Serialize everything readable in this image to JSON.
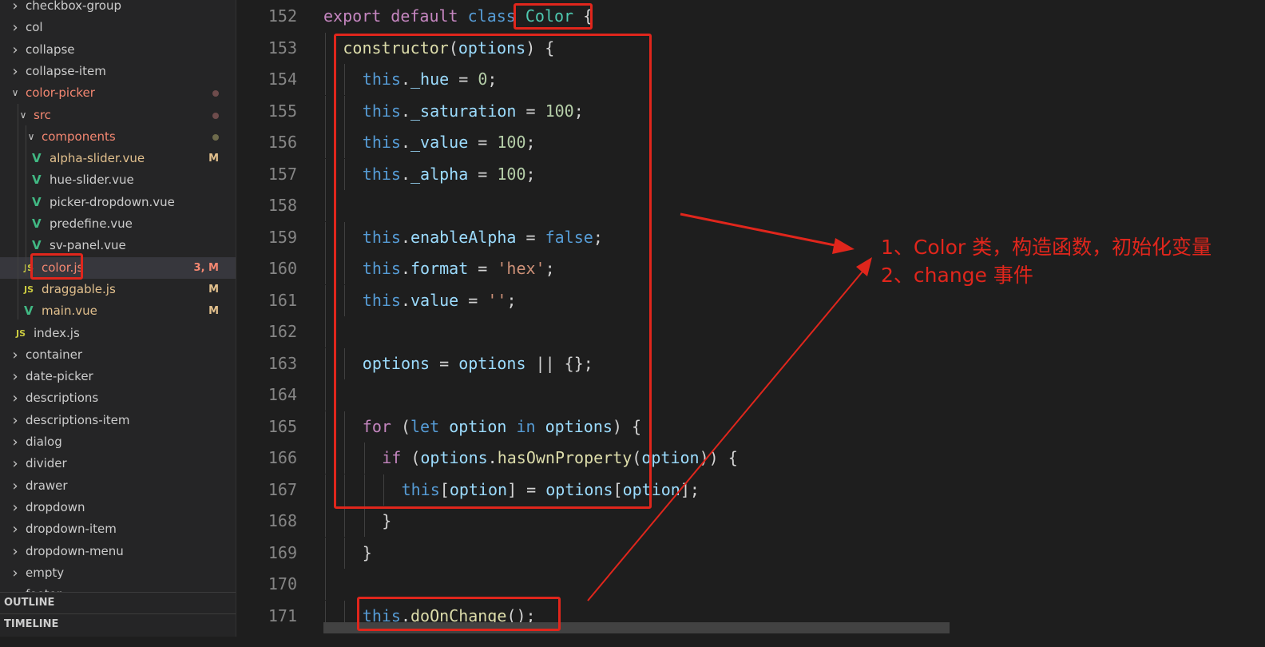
{
  "explorer": {
    "items": [
      {
        "label": "checkbox-group",
        "type": "folder",
        "state": "collapsed"
      },
      {
        "label": "col",
        "type": "folder",
        "state": "collapsed"
      },
      {
        "label": "collapse",
        "type": "folder",
        "state": "collapsed"
      },
      {
        "label": "collapse-item",
        "type": "folder",
        "state": "collapsed"
      },
      {
        "label": "color-picker",
        "type": "folder",
        "state": "expanded",
        "modified_dot": true
      },
      {
        "label": "src",
        "type": "folder",
        "state": "expanded",
        "modified_dot": true
      },
      {
        "label": "components",
        "type": "folder",
        "state": "expanded",
        "modified_dot": true
      },
      {
        "label": "alpha-slider.vue",
        "type": "vue",
        "badge": "M"
      },
      {
        "label": "hue-slider.vue",
        "type": "vue"
      },
      {
        "label": "picker-dropdown.vue",
        "type": "vue"
      },
      {
        "label": "predefine.vue",
        "type": "vue"
      },
      {
        "label": "sv-panel.vue",
        "type": "vue"
      },
      {
        "label": "color.js",
        "type": "js",
        "badge": "3, M",
        "selected": true
      },
      {
        "label": "draggable.js",
        "type": "js",
        "badge": "M"
      },
      {
        "label": "main.vue",
        "type": "vue",
        "badge": "M"
      },
      {
        "label": "index.js",
        "type": "js"
      },
      {
        "label": "container",
        "type": "folder",
        "state": "collapsed"
      },
      {
        "label": "date-picker",
        "type": "folder",
        "state": "collapsed"
      },
      {
        "label": "descriptions",
        "type": "folder",
        "state": "collapsed"
      },
      {
        "label": "descriptions-item",
        "type": "folder",
        "state": "collapsed"
      },
      {
        "label": "dialog",
        "type": "folder",
        "state": "collapsed"
      },
      {
        "label": "divider",
        "type": "folder",
        "state": "collapsed"
      },
      {
        "label": "drawer",
        "type": "folder",
        "state": "collapsed"
      },
      {
        "label": "dropdown",
        "type": "folder",
        "state": "collapsed"
      },
      {
        "label": "dropdown-item",
        "type": "folder",
        "state": "collapsed"
      },
      {
        "label": "dropdown-menu",
        "type": "folder",
        "state": "collapsed"
      },
      {
        "label": "empty",
        "type": "folder",
        "state": "collapsed"
      },
      {
        "label": "footer",
        "type": "folder",
        "state": "collapsed"
      }
    ],
    "outline_label": "OUTLINE",
    "timeline_label": "TIMELINE"
  },
  "icons": {
    "js_glyph": "JS",
    "vue_glyph": "V",
    "chevron_right": "›",
    "chevron_down": "⌄"
  },
  "colors": {
    "accent_red": "#e0261c",
    "modified": "#e2c08d",
    "error_file": "#f48771",
    "selection": "#37373d"
  },
  "editor": {
    "lines": [
      {
        "n": "152",
        "tokens": [
          [
            "export ",
            "kw"
          ],
          [
            "default ",
            "kw"
          ],
          [
            "class ",
            "kwb"
          ],
          [
            "Color",
            "cls"
          ],
          [
            " {",
            "pun"
          ]
        ]
      },
      {
        "n": "153",
        "tokens": [
          [
            "constructor",
            "fn"
          ],
          [
            "(",
            "pun"
          ],
          [
            "options",
            "prop"
          ],
          [
            ") {",
            "pun"
          ]
        ]
      },
      {
        "n": "154",
        "tokens": [
          [
            "this",
            "kwb"
          ],
          [
            ".",
            "pun"
          ],
          [
            "_hue",
            "prop"
          ],
          [
            " = ",
            "pun"
          ],
          [
            "0",
            "num"
          ],
          [
            ";",
            "pun"
          ]
        ]
      },
      {
        "n": "155",
        "tokens": [
          [
            "this",
            "kwb"
          ],
          [
            ".",
            "pun"
          ],
          [
            "_saturation",
            "prop"
          ],
          [
            " = ",
            "pun"
          ],
          [
            "100",
            "num"
          ],
          [
            ";",
            "pun"
          ]
        ]
      },
      {
        "n": "156",
        "tokens": [
          [
            "this",
            "kwb"
          ],
          [
            ".",
            "pun"
          ],
          [
            "_value",
            "prop"
          ],
          [
            " = ",
            "pun"
          ],
          [
            "100",
            "num"
          ],
          [
            ";",
            "pun"
          ]
        ]
      },
      {
        "n": "157",
        "tokens": [
          [
            "this",
            "kwb"
          ],
          [
            ".",
            "pun"
          ],
          [
            "_alpha",
            "prop"
          ],
          [
            " = ",
            "pun"
          ],
          [
            "100",
            "num"
          ],
          [
            ";",
            "pun"
          ]
        ]
      },
      {
        "n": "158",
        "tokens": []
      },
      {
        "n": "159",
        "tokens": [
          [
            "this",
            "kwb"
          ],
          [
            ".",
            "pun"
          ],
          [
            "enableAlpha",
            "prop"
          ],
          [
            " = ",
            "pun"
          ],
          [
            "false",
            "kwb"
          ],
          [
            ";",
            "pun"
          ]
        ]
      },
      {
        "n": "160",
        "tokens": [
          [
            "this",
            "kwb"
          ],
          [
            ".",
            "pun"
          ],
          [
            "format",
            "prop"
          ],
          [
            " = ",
            "pun"
          ],
          [
            "'hex'",
            "str"
          ],
          [
            ";",
            "pun"
          ]
        ]
      },
      {
        "n": "161",
        "tokens": [
          [
            "this",
            "kwb"
          ],
          [
            ".",
            "pun"
          ],
          [
            "value",
            "prop"
          ],
          [
            " = ",
            "pun"
          ],
          [
            "''",
            "str"
          ],
          [
            ";",
            "pun"
          ]
        ]
      },
      {
        "n": "162",
        "tokens": []
      },
      {
        "n": "163",
        "tokens": [
          [
            "options",
            "prop"
          ],
          [
            " = ",
            "pun"
          ],
          [
            "options",
            "prop"
          ],
          [
            " || {};",
            "pun"
          ]
        ]
      },
      {
        "n": "164",
        "tokens": []
      },
      {
        "n": "165",
        "tokens": [
          [
            "for ",
            "kw"
          ],
          [
            "(",
            "pun"
          ],
          [
            "let ",
            "kwb"
          ],
          [
            "option ",
            "prop"
          ],
          [
            "in ",
            "kwb"
          ],
          [
            "options",
            "prop"
          ],
          [
            ") {",
            "pun"
          ]
        ]
      },
      {
        "n": "166",
        "tokens": [
          [
            "if ",
            "kw"
          ],
          [
            "(",
            "pun"
          ],
          [
            "options",
            "prop"
          ],
          [
            ".",
            "pun"
          ],
          [
            "hasOwnProperty",
            "fn"
          ],
          [
            "(",
            "pun"
          ],
          [
            "option",
            "prop"
          ],
          [
            ")) {",
            "pun"
          ]
        ]
      },
      {
        "n": "167",
        "tokens": [
          [
            "this",
            "kwb"
          ],
          [
            "[",
            "pun"
          ],
          [
            "option",
            "prop"
          ],
          [
            "] = ",
            "pun"
          ],
          [
            "options",
            "prop"
          ],
          [
            "[",
            "pun"
          ],
          [
            "option",
            "prop"
          ],
          [
            "];",
            "pun"
          ]
        ]
      },
      {
        "n": "168",
        "tokens": [
          [
            "}",
            "pun"
          ]
        ]
      },
      {
        "n": "169",
        "tokens": [
          [
            "}",
            "pun"
          ]
        ]
      },
      {
        "n": "170",
        "tokens": []
      },
      {
        "n": "171",
        "tokens": [
          [
            "this",
            "kwb"
          ],
          [
            ".",
            "pun"
          ],
          [
            "doOnChange",
            "fn"
          ],
          [
            "();",
            "pun"
          ]
        ]
      }
    ]
  },
  "annotation": {
    "line1": "1、Color 类，构造函数，初始化变量",
    "line2": "2、change 事件"
  }
}
